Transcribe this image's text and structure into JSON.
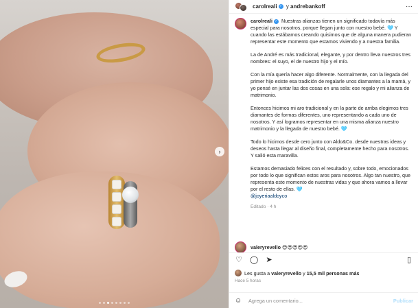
{
  "header": {
    "user1": "carolreali",
    "connector": "y",
    "user2": "andrebankoff"
  },
  "caption": {
    "username": "carolreali",
    "paragraphs": [
      "Nuestras alianzas tienen un significado todavía más especial para nosotros, porque llegan junto con nuestro bebé. 🩵 Y cuando las estábamos creando quisimos que de alguna manera pudieran representar este momento que estamos viviendo y a nuestra familia.",
      "La de André es más tradicional, elegante, y por dentro lleva nuestros tres nombres: el suyo, el de nuestro hijo y el mío.",
      "Con la mía quería hacer algo diferente. Normalmente, con la llegada del primer hijo existe esa tradición de regalarle unos diamantes a la mamá, y yo pensé en juntar las dos cosas en una sola: ese regalo y mi alianza de matrimonio.",
      "Entonces hicimos mi aro tradicional y en la parte de arriba elegimos tres diamantes de formas diferentes, uno representando a cada uno de nosotros. Y así logramos representar en una misma alianza nuestro matrimonio y la llegada de nuestro bebé. 🩵",
      "Todo lo hicimos desde cero junto con Aldo&Co. desde nuestras ideas y deseos hasta llegar al diseño final, completamente hecho para nosotros. Y salió esta maravilla."
    ],
    "last_paragraph": "Estamos demasiado felices con el resultado y, sobre todo, emocionados por todo lo que significan estos aros para nosotros. Algo tan nuestro, que representa este momento de nuestras vidas y que ahora vamos a llevar por el resto de ellas. 🩵",
    "mention": "@joyeriaaldoyco",
    "edited": "Editado · 4 h"
  },
  "comment": {
    "username": "valeryrevello",
    "text": "😍😍😍😍😍"
  },
  "icons": {
    "like": "heart-icon",
    "comment": "comment-icon",
    "share": "share-icon",
    "save": "bookmark-icon",
    "emoji": "emoji-icon",
    "more": "more-icon",
    "next": "chevron-right-icon"
  },
  "likes": {
    "prefix": "Les gusta a",
    "user": "valeryrevello",
    "middle": "y",
    "count": "15,5 mil personas más"
  },
  "time": "Hace 5 horas",
  "add_comment": {
    "placeholder": "Agrega un comentario...",
    "publish": "Publicar"
  },
  "carousel": {
    "total": 8,
    "active": 2
  },
  "colors": {
    "accent": "#3897f0",
    "link": "#00376b",
    "muted": "#8e8e8e",
    "publish_disabled": "#b2dffc"
  }
}
